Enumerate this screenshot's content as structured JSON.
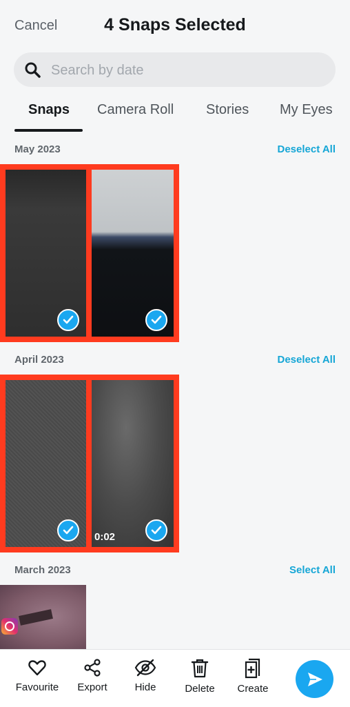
{
  "header": {
    "cancel_label": "Cancel",
    "title": "4 Snaps Selected"
  },
  "search": {
    "placeholder": "Search by date",
    "value": ""
  },
  "tabs": [
    {
      "label": "Snaps",
      "active": true
    },
    {
      "label": "Camera Roll",
      "active": false
    },
    {
      "label": "Stories",
      "active": false
    },
    {
      "label": "My Eyes",
      "active": false
    }
  ],
  "sections": [
    {
      "title": "May 2023",
      "action": "Deselect All",
      "items": [
        {
          "selected": true,
          "duration": ""
        },
        {
          "selected": true,
          "duration": ""
        }
      ]
    },
    {
      "title": "April 2023",
      "action": "Deselect All",
      "items": [
        {
          "selected": true,
          "duration": ""
        },
        {
          "selected": true,
          "duration": "0:02"
        }
      ]
    },
    {
      "title": "March 2023",
      "action": "Select All",
      "items": [
        {
          "selected": false,
          "duration": ""
        }
      ]
    }
  ],
  "bottom_bar": {
    "items": [
      {
        "label": "Favourite",
        "icon": "heart-icon"
      },
      {
        "label": "Export",
        "icon": "share-icon"
      },
      {
        "label": "Hide",
        "icon": "eye-off-icon"
      },
      {
        "label": "Delete",
        "icon": "trash-icon"
      },
      {
        "label": "Create",
        "icon": "create-icon"
      }
    ],
    "send_icon": "send-icon"
  },
  "colors": {
    "accent": "#1aa7f0",
    "link": "#15a6d6",
    "selection_highlight": "#ff3b1f",
    "background": "#f5f6f7"
  }
}
